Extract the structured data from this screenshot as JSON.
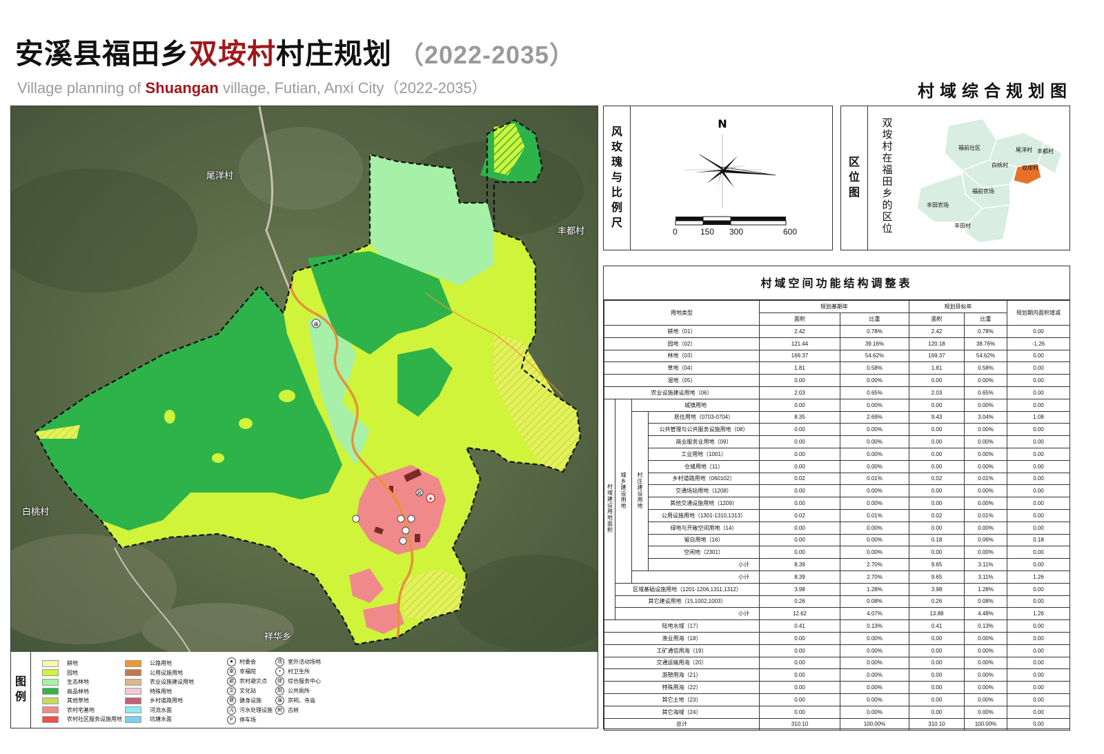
{
  "header": {
    "title_prefix": "安溪县福田乡",
    "title_highlight": "双垵村",
    "title_suffix": "村庄规划",
    "title_years": "（2022-2035）",
    "subtitle_prefix": "Village planning of ",
    "subtitle_highlight": "Shuangan",
    "subtitle_suffix": " village, Futian, Anxi City（2022-2035）",
    "map_type": "村域综合规划图"
  },
  "map": {
    "places": {
      "weiyang": "尾洋村",
      "fengdu": "丰都村",
      "baitao": "白桃村",
      "xianghua": "祥华乡"
    },
    "icon_labels": {
      "temple": "庙",
      "government": "政"
    },
    "colors": {
      "satellite": "#5b6e46",
      "forest_dark": "#2eb24a",
      "forest_ecology": "#a6f0a8",
      "garden": "#cff43a",
      "garden_alt": "#e4f25a",
      "residential": "#f08a8a",
      "road": "#e8913a",
      "boundary": "#111111"
    }
  },
  "legend": {
    "label": [
      "图",
      "例"
    ],
    "items": [
      {
        "label": "耕地",
        "color": "#f7f7b0"
      },
      {
        "label": "园地",
        "color": "#d3f23a"
      },
      {
        "label": "生态林地",
        "color": "#a7f2a0"
      },
      {
        "label": "商品林地",
        "color": "#32b44a"
      },
      {
        "label": "其他草地",
        "color": "#c9d95a"
      },
      {
        "label": "农村宅基地",
        "color": "#f08a8a"
      },
      {
        "label": "农村社区服务设施用地",
        "color": "#f0504a"
      },
      {
        "label": "公路用地",
        "color": "#f0962e"
      },
      {
        "label": "公用设施用地",
        "color": "#c07a4a"
      },
      {
        "label": "农业设施建设用地",
        "color": "#e0b68a"
      },
      {
        "label": "特殊用地",
        "color": "#f5c8d8"
      },
      {
        "label": "乡村道路用地",
        "color": "#c06070"
      },
      {
        "label": "河流水面",
        "color": "#8ee8f0"
      },
      {
        "label": "坑塘水面",
        "color": "#7ad0f0"
      }
    ],
    "icons": [
      {
        "label": "村委会",
        "glyph": "★",
        "name": "village-committee-icon"
      },
      {
        "label": "幸福院",
        "glyph": "幸",
        "name": "happiness-home-icon"
      },
      {
        "label": "农村避灾点",
        "glyph": "避",
        "name": "shelter-icon"
      },
      {
        "label": "文化站",
        "glyph": "文",
        "name": "culture-station-icon"
      },
      {
        "label": "健身设施",
        "glyph": "健",
        "name": "fitness-icon"
      },
      {
        "label": "污水处理设施",
        "glyph": "污",
        "name": "sewage-icon"
      },
      {
        "label": "停车场",
        "glyph": "P",
        "name": "parking-icon"
      },
      {
        "label": "室外活动场地",
        "glyph": "场",
        "name": "outdoor-activity-icon"
      },
      {
        "label": "村卫生所",
        "glyph": "+",
        "name": "clinic-icon"
      },
      {
        "label": "综合服务中心",
        "glyph": "综",
        "name": "service-center-icon"
      },
      {
        "label": "公共厕所",
        "glyph": "厕",
        "name": "toilet-icon"
      },
      {
        "label": "宗祠、寺庙",
        "glyph": "庙",
        "name": "temple-icon"
      },
      {
        "label": "古树",
        "glyph": "树",
        "name": "old-tree-icon"
      }
    ]
  },
  "wind_panel": {
    "label": [
      "风",
      "玫",
      "瑰",
      "与",
      "比",
      "例",
      "尺"
    ],
    "north": "N",
    "scale_ticks": [
      "0",
      "150",
      "300",
      "600"
    ]
  },
  "location_panel": {
    "label": [
      "区",
      "位",
      "图"
    ],
    "description": [
      "双",
      "垵",
      "村",
      "在",
      "福",
      "田",
      "乡",
      "的",
      "区",
      "位"
    ],
    "regions": [
      "福前社区",
      "尾洋村",
      "丰都村",
      "白桃村",
      "双垵村",
      "福前农场",
      "丰田农场",
      "丰田村"
    ]
  },
  "table": {
    "title": "村域空间功能结构调整表",
    "headers": {
      "category": "用地类型",
      "base_year": "规划基期年",
      "target_year": "规划目标年",
      "change": "规划期内面积增减",
      "area": "面积",
      "ratio": "比重"
    },
    "group_labels": {
      "village_construction": "村域建设用地面积",
      "urban_rural": "城乡建设用地",
      "village": "村庄建设用地"
    },
    "rows": [
      {
        "name": "耕地（01）",
        "a1": "2.42",
        "r1": "0.78%",
        "a2": "2.42",
        "r2": "0.78%",
        "d": "0.00"
      },
      {
        "name": "园地（02）",
        "a1": "121.44",
        "r1": "39.16%",
        "a2": "120.18",
        "r2": "38.76%",
        "d": "-1.26"
      },
      {
        "name": "林地（03）",
        "a1": "169.37",
        "r1": "54.62%",
        "a2": "169.37",
        "r2": "54.62%",
        "d": "0.00"
      },
      {
        "name": "草地（04）",
        "a1": "1.81",
        "r1": "0.58%",
        "a2": "1.81",
        "r2": "0.58%",
        "d": "0.00"
      },
      {
        "name": "湿地（05）",
        "a1": "0.00",
        "r1": "0.00%",
        "a2": "0.00",
        "r2": "0.00%",
        "d": "0.00"
      },
      {
        "name": "农业设施建设用地（06）",
        "a1": "2.03",
        "r1": "0.65%",
        "a2": "2.03",
        "r2": "0.65%",
        "d": "0.00"
      },
      {
        "name": "城镇用地",
        "a1": "0.00",
        "r1": "0.00%",
        "a2": "0.00",
        "r2": "0.00%",
        "d": "0.00"
      },
      {
        "name": "居住用地（0703-0704）",
        "a1": "8.35",
        "r1": "2.69%",
        "a2": "9.43",
        "r2": "3.04%",
        "d": "1.08"
      },
      {
        "name": "公共管理与公共服务设施用地（08）",
        "a1": "0.00",
        "r1": "0.00%",
        "a2": "0.00",
        "r2": "0.00%",
        "d": "0.00"
      },
      {
        "name": "商业服务业用地（09）",
        "a1": "0.00",
        "r1": "0.00%",
        "a2": "0.00",
        "r2": "0.00%",
        "d": "0.00"
      },
      {
        "name": "工业用地（1001）",
        "a1": "0.00",
        "r1": "0.00%",
        "a2": "0.00",
        "r2": "0.00%",
        "d": "0.00"
      },
      {
        "name": "仓储用地（11）",
        "a1": "0.00",
        "r1": "0.00%",
        "a2": "0.00",
        "r2": "0.00%",
        "d": "0.00"
      },
      {
        "name": "乡村道路用地（060102）",
        "a1": "0.02",
        "r1": "0.01%",
        "a2": "0.02",
        "r2": "0.01%",
        "d": "0.00"
      },
      {
        "name": "交通场站用地（1208）",
        "a1": "0.00",
        "r1": "0.00%",
        "a2": "0.00",
        "r2": "0.00%",
        "d": "0.00"
      },
      {
        "name": "其他交通设施用地（1209）",
        "a1": "0.00",
        "r1": "0.00%",
        "a2": "0.00",
        "r2": "0.00%",
        "d": "0.00"
      },
      {
        "name": "公用设施用地（1301-1310,1313）",
        "a1": "0.02",
        "r1": "0.01%",
        "a2": "0.02",
        "r2": "0.01%",
        "d": "0.00"
      },
      {
        "name": "绿地与开敞空间用地（14）",
        "a1": "0.00",
        "r1": "0.00%",
        "a2": "0.00",
        "r2": "0.00%",
        "d": "0.00"
      },
      {
        "name": "留白用地（16）",
        "a1": "0.00",
        "r1": "0.00%",
        "a2": "0.18",
        "r2": "0.06%",
        "d": "0.18"
      },
      {
        "name": "空闲地（2301）",
        "a1": "0.00",
        "r1": "0.00%",
        "a2": "0.00",
        "r2": "0.00%",
        "d": "0.00"
      },
      {
        "name": "小计",
        "a1": "8.39",
        "r1": "2.70%",
        "a2": "9.65",
        "r2": "3.11%",
        "d": "0.00"
      },
      {
        "name": "小计",
        "a1": "8.39",
        "r1": "2.70%",
        "a2": "9.65",
        "r2": "3.11%",
        "d": "1.26"
      },
      {
        "name": "区域基础设施用地（1201-1206,1311,1312）",
        "a1": "3.98",
        "r1": "1.28%",
        "a2": "3.98",
        "r2": "1.28%",
        "d": "0.00"
      },
      {
        "name": "其它建设用地（15,1002,1003）",
        "a1": "0.26",
        "r1": "0.08%",
        "a2": "0.26",
        "r2": "0.08%",
        "d": "0.00"
      },
      {
        "name": "小计",
        "a1": "12.62",
        "r1": "4.07%",
        "a2": "13.88",
        "r2": "4.48%",
        "d": "1.26"
      },
      {
        "name": "陆地水域（17）",
        "a1": "0.41",
        "r1": "0.13%",
        "a2": "0.41",
        "r2": "0.13%",
        "d": "0.00"
      },
      {
        "name": "渔业用海（18）",
        "a1": "0.00",
        "r1": "0.00%",
        "a2": "0.00",
        "r2": "0.00%",
        "d": "0.00"
      },
      {
        "name": "工矿通信用海（19）",
        "a1": "0.00",
        "r1": "0.00%",
        "a2": "0.00",
        "r2": "0.00%",
        "d": "0.00"
      },
      {
        "name": "交通运输用海（20）",
        "a1": "0.00",
        "r1": "0.00%",
        "a2": "0.00",
        "r2": "0.00%",
        "d": "0.00"
      },
      {
        "name": "游憩用海（21）",
        "a1": "0.00",
        "r1": "0.00%",
        "a2": "0.00",
        "r2": "0.00%",
        "d": "0.00"
      },
      {
        "name": "特殊用海（22）",
        "a1": "0.00",
        "r1": "0.00%",
        "a2": "0.00",
        "r2": "0.00%",
        "d": "0.00"
      },
      {
        "name": "其它土地（23）",
        "a1": "0.00",
        "r1": "0.00%",
        "a2": "0.00",
        "r2": "0.00%",
        "d": "0.00"
      },
      {
        "name": "其它海域（24）",
        "a1": "0.00",
        "r1": "0.00%",
        "a2": "0.00",
        "r2": "0.00%",
        "d": "0.00"
      },
      {
        "name": "总计",
        "a1": "310.10",
        "r1": "100.00%",
        "a2": "310.10",
        "r2": "100.00%",
        "d": "0.00"
      }
    ]
  }
}
